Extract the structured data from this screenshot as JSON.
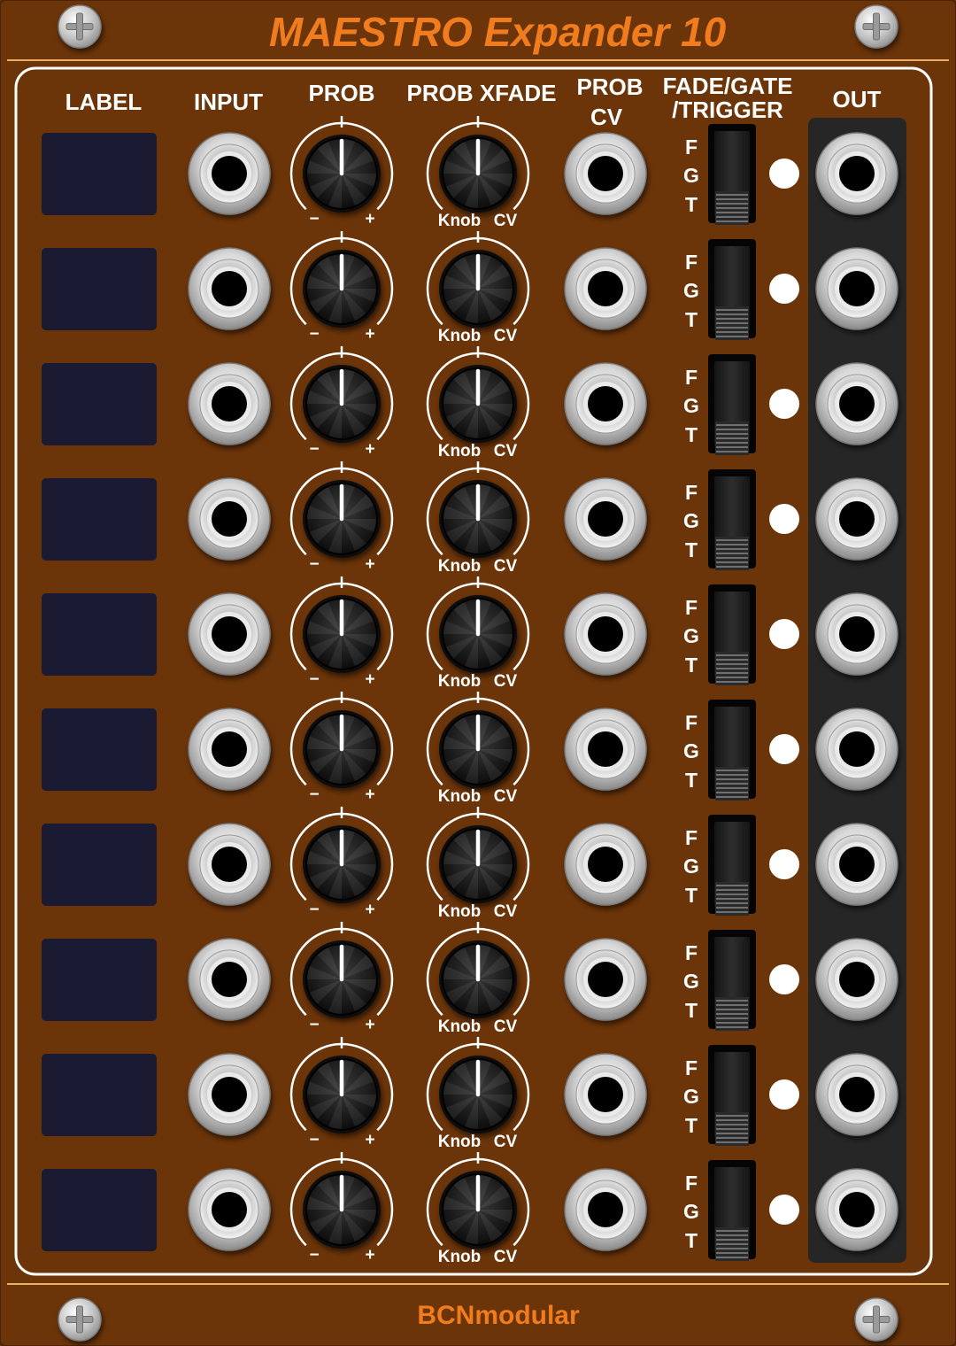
{
  "module": {
    "title": "MAESTRO Expander 10",
    "brand": "BCNmodular",
    "colors": {
      "panel": "#6b3409",
      "accent": "#f07c1e",
      "line": "#e8b060",
      "out_section": "#262626",
      "label_box": "#1a1b33",
      "led": "#ffffff"
    }
  },
  "columns": {
    "label": "LABEL",
    "input": "INPUT",
    "prob": "PROB",
    "prob_xfade": "PROB XFADE",
    "prob_cv_1": "PROB",
    "prob_cv_2": "CV",
    "fade_1": "FADE/GATE",
    "fade_2": "/TRIGGER",
    "out": "OUT"
  },
  "knob_labels": {
    "minus": "−",
    "plus": "+",
    "knob": "Knob",
    "cv": "CV"
  },
  "switch_labels": {
    "f": "F",
    "g": "G",
    "t": "T"
  },
  "channels": [
    {
      "index": 1,
      "label_text": "",
      "switch": "T",
      "led_on": true
    },
    {
      "index": 2,
      "label_text": "",
      "switch": "T",
      "led_on": true
    },
    {
      "index": 3,
      "label_text": "",
      "switch": "T",
      "led_on": true
    },
    {
      "index": 4,
      "label_text": "",
      "switch": "T",
      "led_on": true
    },
    {
      "index": 5,
      "label_text": "",
      "switch": "T",
      "led_on": true
    },
    {
      "index": 6,
      "label_text": "",
      "switch": "T",
      "led_on": true
    },
    {
      "index": 7,
      "label_text": "",
      "switch": "T",
      "led_on": true
    },
    {
      "index": 8,
      "label_text": "",
      "switch": "T",
      "led_on": true
    },
    {
      "index": 9,
      "label_text": "",
      "switch": "T",
      "led_on": true
    },
    {
      "index": 10,
      "label_text": "",
      "switch": "T",
      "led_on": true
    }
  ]
}
